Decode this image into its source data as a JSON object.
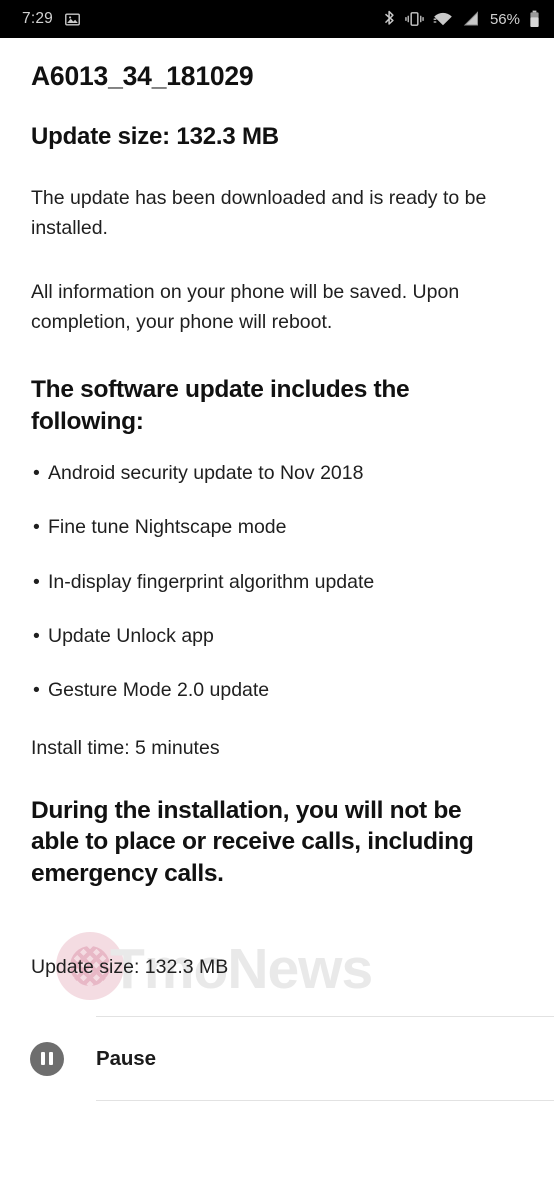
{
  "status_bar": {
    "time": "7:29",
    "battery_percent": "56%",
    "icons": [
      "image-notification-icon",
      "bluetooth-icon",
      "vibrate-icon",
      "wifi-icon",
      "cellular-signal-icon",
      "battery-icon"
    ],
    "background_color": "#000000",
    "foreground_color": "#c9c9c9"
  },
  "update": {
    "title": "A6013_34_181029",
    "size_heading": "Update size: 132.3 MB",
    "paragraph_1": "The update has been downloaded and is ready to be installed.",
    "paragraph_2": "All information on your phone will be saved. Upon completion, your phone will reboot.",
    "changelog_heading": "The software update includes the following:",
    "changelog": [
      "Android security update to Nov 2018",
      "Fine tune Nightscape mode",
      "In-display fingerprint algorithm update",
      "Update Unlock app",
      "Gesture Mode 2.0 update"
    ],
    "bullet_glyph": "•",
    "install_time": "Install time: 5 minutes",
    "warning": "During the installation, you will not be able to place or receive calls, including emergency calls.",
    "size_footer": "Update size: 132.3 MB"
  },
  "actions": {
    "pause_label": "Pause",
    "pause_icon": "pause-circle-icon",
    "pause_icon_color": "#6e6e6e",
    "divider_color": "#e2e2e2"
  },
  "watermark": {
    "text": "TmoNews",
    "text_color": "#e9e9e9",
    "logo_color": "#f3d7de"
  }
}
